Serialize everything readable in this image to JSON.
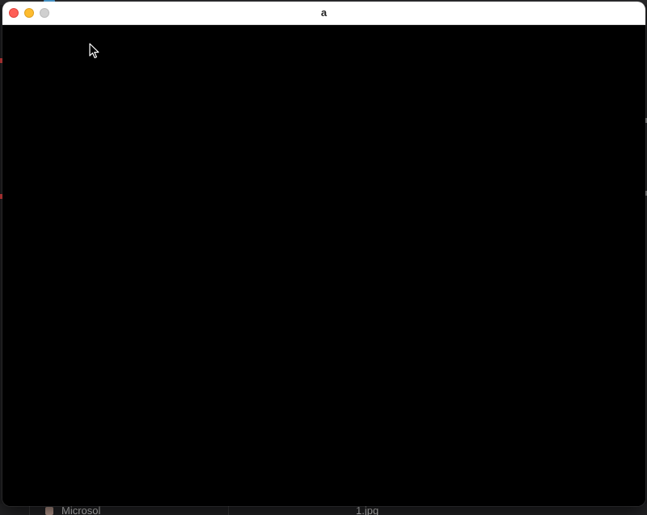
{
  "window": {
    "title": "a",
    "controls": {
      "close": "#fe5f57",
      "minimize": "#febc2e",
      "zoom": "#d0d0d0"
    },
    "content_background": "#000000"
  },
  "background_app": {
    "sidebar_item_label": "Microsol",
    "file_label": "1.jpg"
  },
  "cursor": {
    "icon": "arrow-pointer-icon"
  }
}
